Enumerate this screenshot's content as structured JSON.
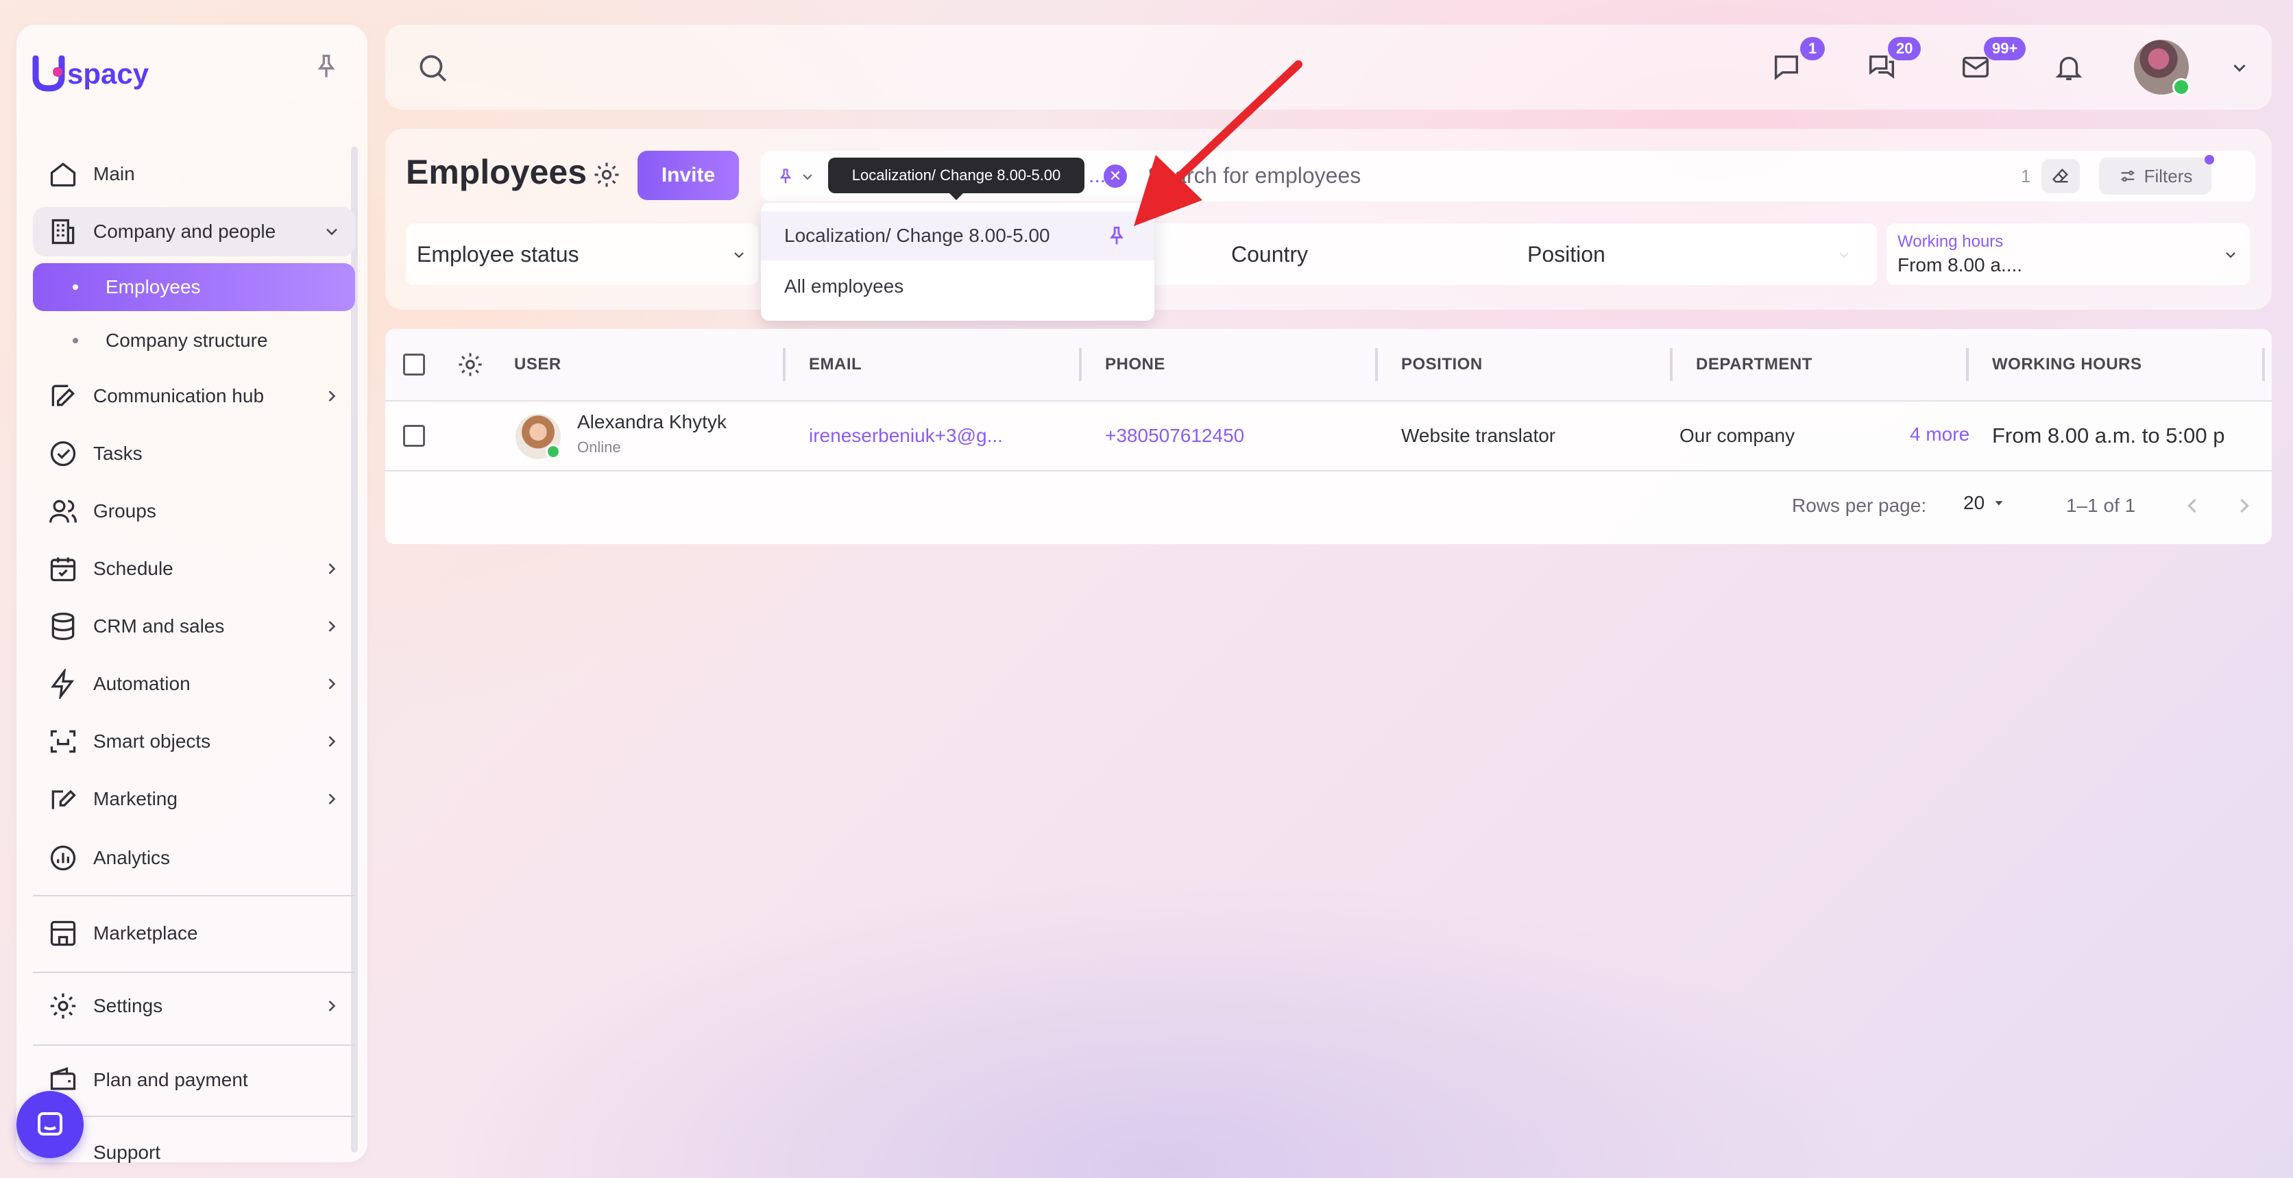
{
  "brand": {
    "logo_text": "spacy"
  },
  "sidebar": {
    "items": [
      {
        "label": "Main",
        "icon": "home-icon"
      },
      {
        "label": "Company and people",
        "icon": "building-icon"
      },
      {
        "label": "Employees"
      },
      {
        "label": "Company structure"
      },
      {
        "label": "Communication hub",
        "icon": "chat-pen-icon"
      },
      {
        "label": "Tasks",
        "icon": "check-circle-icon"
      },
      {
        "label": "Groups",
        "icon": "users-icon"
      },
      {
        "label": "Schedule",
        "icon": "calendar-icon"
      },
      {
        "label": "CRM and sales",
        "icon": "database-icon"
      },
      {
        "label": "Automation",
        "icon": "lightning-icon"
      },
      {
        "label": "Smart objects",
        "icon": "scan-icon"
      },
      {
        "label": "Marketing",
        "icon": "edit-icon"
      },
      {
        "label": "Analytics",
        "icon": "chart-icon"
      },
      {
        "label": "Marketplace",
        "icon": "store-icon"
      },
      {
        "label": "Settings",
        "icon": "gear-icon"
      },
      {
        "label": "Plan and payment",
        "icon": "wallet-icon"
      },
      {
        "label": "Support"
      }
    ]
  },
  "topbar": {
    "badges": {
      "messages": "1",
      "chats": "20",
      "mail": "99+"
    }
  },
  "page": {
    "title": "Employees",
    "invite_label": "Invite",
    "search_placeholder": "Search for employees",
    "filter_count": "1",
    "filters_label": "Filters",
    "chip_tail": "..."
  },
  "filters": {
    "employee_status": "Employee status",
    "country": "Country",
    "position": "Position",
    "working_hours_label": "Working hours",
    "working_hours_value": "From 8.00 a...."
  },
  "dropdown": {
    "items": [
      "Localization/ Change 8.00-5.00",
      "All employees"
    ],
    "tooltip": "Localization/ Change 8.00-5.00"
  },
  "table": {
    "headers": [
      "USER",
      "EMAIL",
      "PHONE",
      "POSITION",
      "DEPARTMENT",
      "WORKING HOURS"
    ],
    "rows": [
      {
        "name": "Alexandra Khytyk",
        "status": "Online",
        "email": "ireneserbeniuk+3@g...",
        "phone": "+380507612450",
        "position": "Website translator",
        "department": "Our company",
        "more": "4 more",
        "working_hours": "From 8.00 a.m. to 5:00 p"
      }
    ],
    "footer": {
      "rows_per_page_label": "Rows per page:",
      "rows_per_page": "20",
      "range": "1–1 of 1"
    }
  },
  "colors": {
    "accent": "#8b5cf6",
    "brand": "#5b3df5",
    "annotation_arrow": "#e8252a",
    "online": "#36c35a"
  }
}
